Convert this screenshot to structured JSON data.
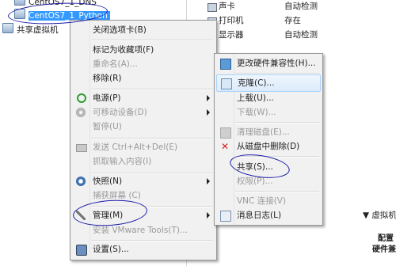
{
  "tree": {
    "items": [
      {
        "label": "CentOS7_1_DNS"
      },
      {
        "label": "CentOS7_1_Python",
        "selected": true
      },
      {
        "label": "共享虚拟机"
      }
    ]
  },
  "devices": [
    {
      "name": "声卡",
      "value": "自动检测"
    },
    {
      "name": "打印机",
      "value": "存在"
    },
    {
      "name": "显示器",
      "value": "自动检测"
    }
  ],
  "vm_panel": {
    "title": "▼ 虚拟机",
    "line1": "配置",
    "line2": "硬件兼"
  },
  "context_menu": {
    "items": [
      {
        "label": "关闭选项卡(B)",
        "disabled": false
      },
      {
        "label": "标记为收藏项(F)",
        "disabled": false
      },
      {
        "label": "重命名(A)...",
        "disabled": true
      },
      {
        "label": "移除(R)",
        "disabled": false
      },
      {
        "label": "电源(P)",
        "disabled": false,
        "submenu": true,
        "icon": "power-icon"
      },
      {
        "label": "可移动设备(D)",
        "disabled": true,
        "submenu": true,
        "icon": "disc-icon"
      },
      {
        "label": "暂停(U)",
        "disabled": true
      },
      {
        "label": "发送 Ctrl+Alt+Del(E)",
        "disabled": true,
        "icon": "keyboard-icon"
      },
      {
        "label": "抓取输入内容(I)",
        "disabled": true
      },
      {
        "label": "快照(N)",
        "disabled": false,
        "submenu": true,
        "icon": "snapshot-icon"
      },
      {
        "label": "捕获屏幕 (C)",
        "disabled": true
      },
      {
        "label": "管理(M)",
        "disabled": false,
        "submenu": true,
        "icon": "wrench-icon"
      },
      {
        "label": "安装 VMware Tools(T)...",
        "disabled": true
      },
      {
        "label": "设置(S)...",
        "disabled": false,
        "icon": "settings-icon"
      }
    ]
  },
  "submenu": {
    "items": [
      {
        "label": "更改硬件兼容性(H)...",
        "disabled": false,
        "icon": "hardware-icon"
      },
      {
        "label": "克隆(C)...",
        "disabled": false,
        "icon": "clone-icon",
        "highlighted": true
      },
      {
        "label": "上载(U)...",
        "disabled": false
      },
      {
        "label": "下载(W)...",
        "disabled": true
      },
      {
        "label": "清理磁盘(E)...",
        "disabled": true,
        "icon": "clean-disk-icon"
      },
      {
        "label": "从磁盘中删除(D)",
        "disabled": false,
        "icon": "delete-icon"
      },
      {
        "label": "共享(S)...",
        "disabled": false
      },
      {
        "label": "权限(P)...",
        "disabled": true
      },
      {
        "label": "VNC 连接(V)",
        "disabled": true
      },
      {
        "label": "消息日志(L)",
        "disabled": false,
        "icon": "log-icon"
      }
    ]
  },
  "colors": {
    "selection": "#3399ff",
    "ink": "#1a1aa8",
    "disabled_text": "#9a9a9a"
  }
}
